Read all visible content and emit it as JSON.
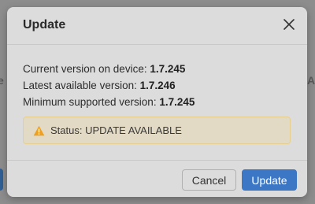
{
  "background": {
    "left_fragment": "e",
    "right_fragment": "A"
  },
  "dialog": {
    "title": "Update",
    "close_icon": "close-icon",
    "current_version_label": "Current version on device:",
    "current_version_value": "1.7.245",
    "latest_version_label": "Latest available version:",
    "latest_version_value": "1.7.246",
    "minimum_version_label": "Minimum supported version:",
    "minimum_version_value": "1.7.245",
    "status_icon": "warning-icon",
    "status_text": "Status: UPDATE AVAILABLE",
    "cancel_label": "Cancel",
    "update_label": "Update"
  },
  "colors": {
    "primary": "#3b77c4",
    "warning_bg": "#e2dac4",
    "warning_border": "#e6cf8e",
    "warning_icon": "#f0a020"
  }
}
